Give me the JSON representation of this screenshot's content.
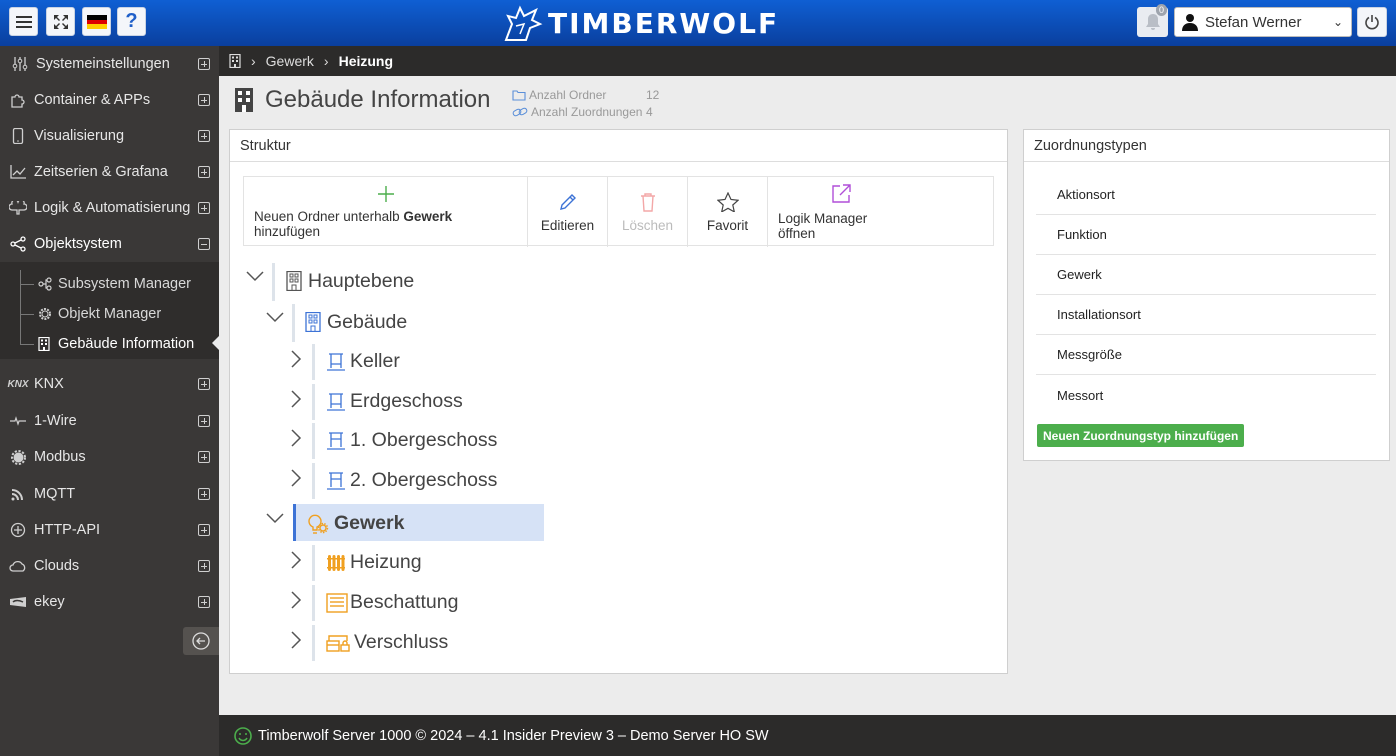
{
  "topbar": {
    "brand": "TIMBERWOLF",
    "notification_count": "0",
    "user_name": "Stefan Werner"
  },
  "sidebar": {
    "items": [
      {
        "label": "Systemeinstellungen",
        "icon": "sliders-icon"
      },
      {
        "label": "Container & APPs",
        "icon": "puzzle-icon"
      },
      {
        "label": "Visualisierung",
        "icon": "phone-icon"
      },
      {
        "label": "Zeitserien & Grafana",
        "icon": "chart-icon"
      },
      {
        "label": "Logik & Automatisierung",
        "icon": "brain-icon"
      },
      {
        "label": "Objektsystem",
        "icon": "share-icon"
      },
      {
        "label": "KNX",
        "icon": "knx-icon"
      },
      {
        "label": "1-Wire",
        "icon": "wire-icon"
      },
      {
        "label": "Modbus",
        "icon": "gear-icon"
      },
      {
        "label": "MQTT",
        "icon": "rss-icon"
      },
      {
        "label": "HTTP-API",
        "icon": "api-icon"
      },
      {
        "label": "Clouds",
        "icon": "cloud-icon"
      },
      {
        "label": "ekey",
        "icon": "ekey-icon"
      }
    ],
    "subitems": [
      {
        "label": "Subsystem Manager",
        "icon": "network-icon"
      },
      {
        "label": "Objekt Manager",
        "icon": "cog-icon"
      },
      {
        "label": "Gebäude Information",
        "icon": "building-icon"
      }
    ]
  },
  "breadcrumb": {
    "parent": "Gewerk",
    "current": "Heizung"
  },
  "header": {
    "title": "Gebäude Information",
    "stats": [
      {
        "label": "Anzahl Ordner",
        "value": "12"
      },
      {
        "label": "Anzahl Zuordnungen",
        "value": "4"
      }
    ]
  },
  "struktur": {
    "title": "Struktur",
    "toolbar": {
      "add_prefix": "Neuen Ordner unterhalb",
      "add_bold": "Gewerk",
      "add_suffix": "hinzufügen",
      "edit": "Editieren",
      "delete": "Löschen",
      "favorite": "Favorit",
      "logic": "Logik Manager öffnen"
    },
    "tree": {
      "root": "Hauptebene",
      "gebaeude": "Gebäude",
      "keller": "Keller",
      "erdgeschoss": "Erdgeschoss",
      "og1": "1. Obergeschoss",
      "og2": "2. Obergeschoss",
      "gewerk": "Gewerk",
      "heizung": "Heizung",
      "beschattung": "Beschattung",
      "verschluss": "Verschluss"
    }
  },
  "zuordnung": {
    "title": "Zuordnungstypen",
    "types": [
      "Aktionsort",
      "Funktion",
      "Gewerk",
      "Installationsort",
      "Messgröße",
      "Messort"
    ],
    "add_label": "Neuen Zuordnungstyp hinzufügen"
  },
  "footer": {
    "text": "Timberwolf Server 1000 © 2024 – 4.1 Insider Preview 3 – Demo Server HO SW"
  },
  "colors": {
    "topbar": "#0a4fc0",
    "sidebar": "#3a3837",
    "accent_green": "#4cae4c",
    "folder_blue": "#3d73d6",
    "folder_orange": "#f0a020"
  }
}
